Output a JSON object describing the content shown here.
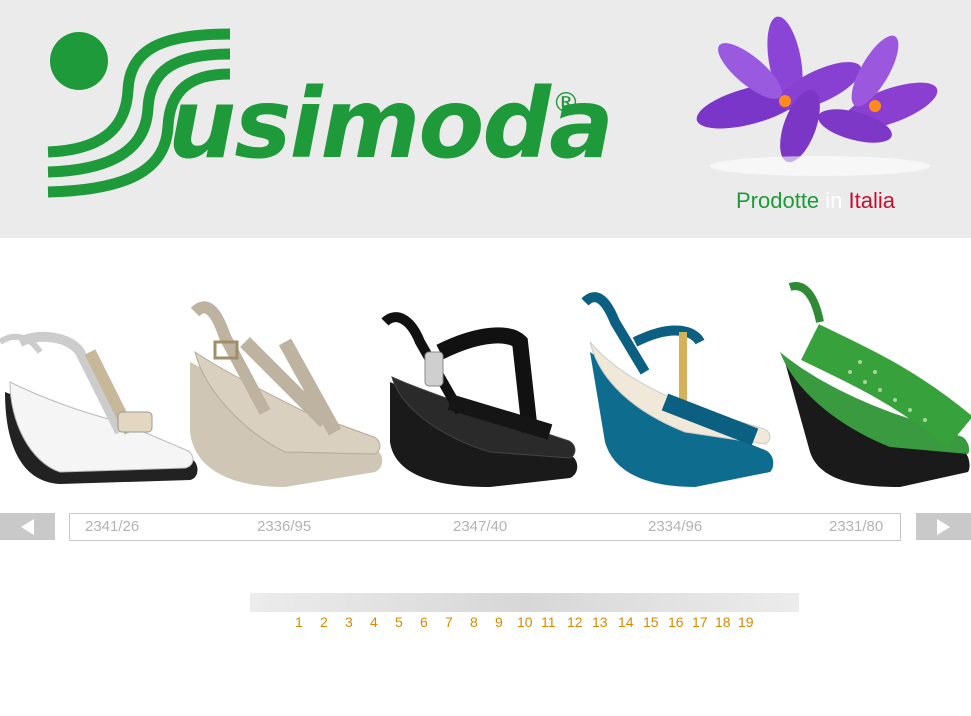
{
  "header": {
    "brand": "usimoda",
    "registered_mark": "®",
    "tagline": {
      "word1": "Prodotte",
      "word2": "in",
      "word3": "Italia"
    },
    "colors": {
      "brand_green": "#1f9a3b",
      "italy_red": "#c8102e",
      "flower_purple": "#8a3fd0"
    }
  },
  "carousel": {
    "prev_icon": "arrow-left-icon",
    "next_icon": "arrow-right-icon",
    "products": [
      {
        "code": "2341/26",
        "color": "white-beige"
      },
      {
        "code": "2336/95",
        "color": "taupe"
      },
      {
        "code": "2347/40",
        "color": "black"
      },
      {
        "code": "2334/96",
        "color": "teal"
      },
      {
        "code": "2331/80",
        "color": "green"
      }
    ]
  },
  "pagination": {
    "pages": [
      "1",
      "2",
      "3",
      "4",
      "5",
      "6",
      "7",
      "8",
      "9",
      "10",
      "11",
      "12",
      "13",
      "14",
      "15",
      "16",
      "17",
      "18",
      "19"
    ],
    "link_color": "#d88a00"
  }
}
